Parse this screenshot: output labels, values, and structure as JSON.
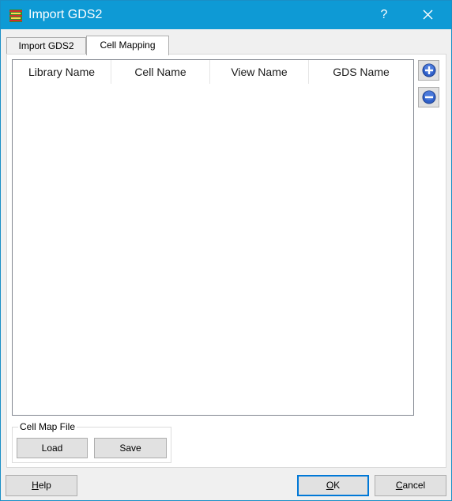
{
  "window": {
    "title": "Import GDS2",
    "help_glyph": "?"
  },
  "tabs": [
    {
      "label": "Import GDS2",
      "active": false
    },
    {
      "label": "Cell Mapping",
      "active": true
    }
  ],
  "table": {
    "columns": [
      "Library Name",
      "Cell Name",
      "View Name",
      "GDS Name"
    ],
    "rows": []
  },
  "side_buttons": {
    "add_icon": "plus-circle-icon",
    "remove_icon": "minus-circle-icon"
  },
  "cell_map_file": {
    "title": "Cell Map File",
    "load_label": "Load",
    "save_label": "Save"
  },
  "footer": {
    "help_label_prefix": "",
    "help_label_mnemonic": "H",
    "help_label_rest": "elp",
    "ok_mnemonic": "O",
    "ok_rest": "K",
    "cancel_mnemonic": "C",
    "cancel_rest": "ancel"
  },
  "colors": {
    "titlebar": "#0e9ad5",
    "accent": "#0078d7"
  }
}
